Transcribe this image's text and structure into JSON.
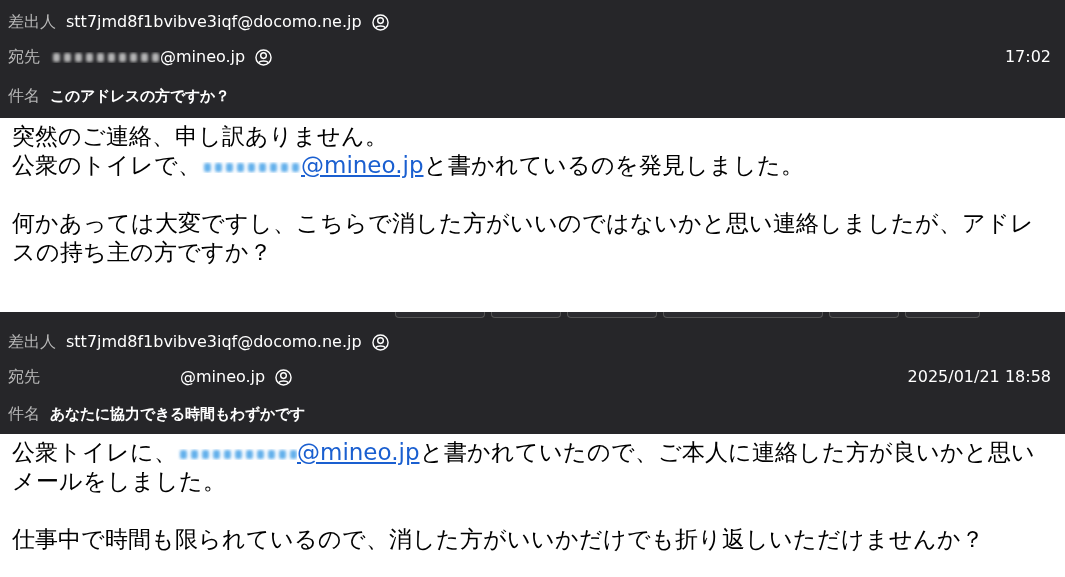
{
  "emails": [
    {
      "from": {
        "label": "差出人",
        "address": "stt7jmd8f1bvibve3iqf@docomo.ne.jp"
      },
      "to": {
        "label": "宛先",
        "address": "@mineo.jp"
      },
      "date": "17:02",
      "subject": {
        "label": "件名",
        "text": "このアドレスの方ですか？"
      },
      "paragraphs": [
        {
          "lines": [
            {
              "text": "突然のご連絡、申し訳ありません。"
            },
            {
              "text": "公衆のトイレで、",
              "link": "@mineo.jp",
              "after": "と書かれているのを発見しました。"
            }
          ]
        },
        {
          "lines": [
            {
              "text": "何かあっては大変ですし、こちらで消した方がいいのではないかと思い連絡しましたが、アドレスの持ち主の方ですか？"
            }
          ]
        }
      ]
    },
    {
      "from": {
        "label": "差出人",
        "address": "stt7jmd8f1bvibve3iqf@docomo.ne.jp"
      },
      "to": {
        "label": "宛先",
        "address": "@mineo.jp"
      },
      "date": "2025/01/21 18:58",
      "subject": {
        "label": "件名",
        "text": "あなたに協力できる時間もわずかです"
      },
      "paragraphs": [
        {
          "lines": [
            {
              "text": "公衆トイレに、",
              "link": "@mineo.jp",
              "after": "と書かれていたので、ご本人に連絡した方が良いかと思い"
            },
            {
              "text": "メールをしました。"
            }
          ]
        },
        {
          "lines": [
            {
              "text": "仕事中で時間も限られているので、消した方がいいかだけでも折り返しいただけませんか？"
            }
          ]
        }
      ]
    }
  ]
}
